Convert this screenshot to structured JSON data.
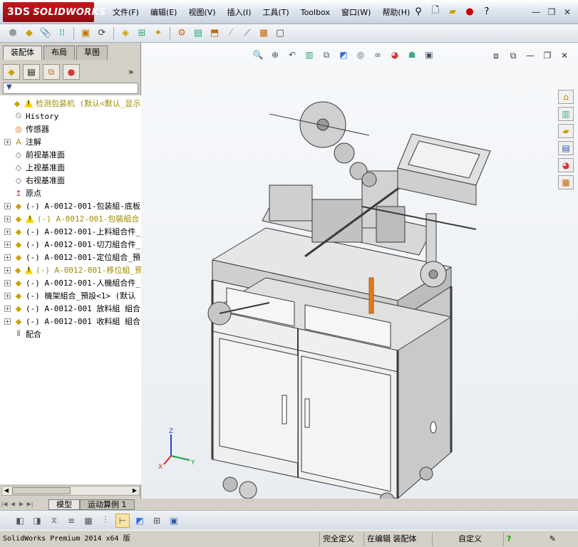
{
  "app": {
    "logo_text": "SOLIDWORKS",
    "logo_mark": "3DS"
  },
  "menu": [
    "文件(F)",
    "编辑(E)",
    "视图(V)",
    "插入(I)",
    "工具(T)",
    "Toolbox",
    "窗口(W)",
    "帮助(H)"
  ],
  "left_panel": {
    "tabs": [
      "装配体",
      "布局",
      "草图"
    ],
    "active_tab": "装配体",
    "more": "»"
  },
  "tree": [
    {
      "label": "检测包装机  (默认<默认_显示",
      "icon": "assembly-icon",
      "warn": true,
      "expand": "",
      "kind": "root",
      "indent": 0
    },
    {
      "label": "History",
      "icon": "history-icon",
      "warn": false,
      "expand": "",
      "kind": "normal",
      "indent": 1
    },
    {
      "label": "传感器",
      "icon": "sensor-icon",
      "warn": false,
      "expand": "",
      "kind": "normal",
      "indent": 1
    },
    {
      "label": "注解",
      "icon": "annotation-icon",
      "warn": false,
      "expand": "+",
      "kind": "normal",
      "indent": 1
    },
    {
      "label": "前视基准面",
      "icon": "plane-icon",
      "warn": false,
      "expand": "",
      "kind": "normal",
      "indent": 1
    },
    {
      "label": "上视基准面",
      "icon": "plane-icon",
      "warn": false,
      "expand": "",
      "kind": "normal",
      "indent": 1
    },
    {
      "label": "右视基准面",
      "icon": "plane-icon",
      "warn": false,
      "expand": "",
      "kind": "normal",
      "indent": 1
    },
    {
      "label": "原点",
      "icon": "origin-icon",
      "warn": false,
      "expand": "",
      "kind": "normal",
      "indent": 1
    },
    {
      "label": "(-) A-0012-001-包装組-底板",
      "icon": "subassembly-icon",
      "warn": false,
      "expand": "+",
      "kind": "normal",
      "indent": 1
    },
    {
      "label": "(-) A-0012-001-包裝組合",
      "icon": "subassembly-icon",
      "warn": true,
      "expand": "+",
      "kind": "yellow",
      "indent": 1
    },
    {
      "label": "(-) A-0012-001-上料組合件_",
      "icon": "subassembly-icon",
      "warn": false,
      "expand": "+",
      "kind": "normal",
      "indent": 1
    },
    {
      "label": "(-) A-0012-001-切刀組合件_",
      "icon": "subassembly-icon",
      "warn": false,
      "expand": "+",
      "kind": "normal",
      "indent": 1
    },
    {
      "label": "(-) A-0012-001-定位組合_預",
      "icon": "subassembly-icon",
      "warn": false,
      "expand": "+",
      "kind": "normal",
      "indent": 1
    },
    {
      "label": "(-) A-0012-001-移位組_預",
      "icon": "subassembly-icon",
      "warn": true,
      "expand": "+",
      "kind": "yellow",
      "indent": 1
    },
    {
      "label": "(-) A-0012-001-人機組合件_",
      "icon": "subassembly-icon",
      "warn": false,
      "expand": "+",
      "kind": "normal",
      "indent": 1
    },
    {
      "label": "(-) 機架組合_預設<1> (默认",
      "icon": "subassembly-icon",
      "warn": false,
      "expand": "+",
      "kind": "normal",
      "indent": 1
    },
    {
      "label": "(-) A-0012-001 放料組 組合",
      "icon": "subassembly-icon",
      "warn": false,
      "expand": "+",
      "kind": "normal",
      "indent": 1
    },
    {
      "label": "(-) A-0012-001 收料組 組合",
      "icon": "subassembly-icon",
      "warn": false,
      "expand": "+",
      "kind": "normal",
      "indent": 1
    },
    {
      "label": "配合",
      "icon": "mates-icon",
      "warn": false,
      "expand": "",
      "kind": "normal",
      "indent": 1
    }
  ],
  "triad": {
    "x": "X",
    "y": "Y",
    "z": "Z"
  },
  "bottom_tabs": [
    "模型",
    "运动算例 1"
  ],
  "active_bottom_tab": "模型",
  "status": {
    "app": "SolidWorks Premium 2014 x64 版",
    "defined": "完全定义",
    "mode": "在编辑 装配体",
    "units": "自定义",
    "help": "?"
  }
}
